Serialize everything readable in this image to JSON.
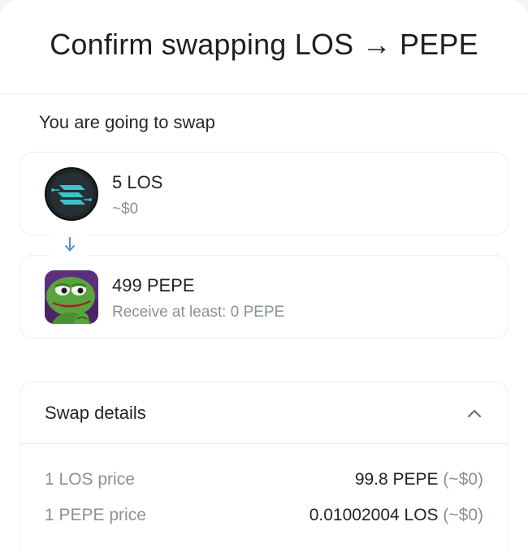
{
  "header": {
    "title": "Confirm swapping LOS → PEPE"
  },
  "swap": {
    "section_label": "You are going to swap",
    "from": {
      "amount": "5 LOS",
      "sub": "~$0",
      "logo_icon": "los-token-icon"
    },
    "to": {
      "amount": "499 PEPE",
      "sub": "Receive at least: 0 PEPE",
      "logo_icon": "pepe-token-icon"
    },
    "direction_icon": "arrow-down-icon"
  },
  "details": {
    "title": "Swap details",
    "expanded": true,
    "rows": [
      {
        "label": "1 LOS price",
        "value": "99.8 PEPE",
        "usd": "(~$0)"
      },
      {
        "label": "1 PEPE price",
        "value": "0.01002004 LOS",
        "usd": "(~$0)"
      }
    ]
  },
  "colors": {
    "accent": "#4a90e2",
    "muted": "#8a9098",
    "border": "#eceef1",
    "los_teal": "#3fc1c9"
  }
}
